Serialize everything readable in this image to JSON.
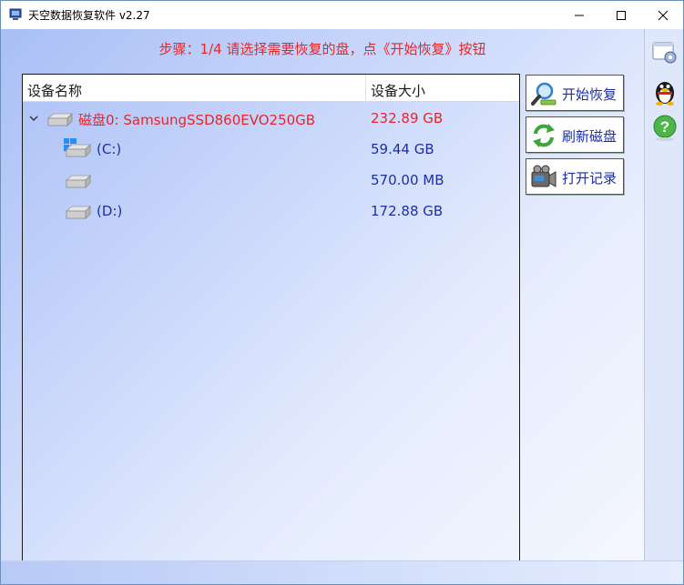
{
  "window": {
    "title": "天空数据恢复软件 v2.27"
  },
  "step": {
    "text": "步骤：1/4 请选择需要恢复的盘，点《开始恢复》按钮"
  },
  "device_list": {
    "columns": [
      "设备名称",
      "设备大小"
    ],
    "disk": {
      "name": "磁盘0: SamsungSSD860EVO250GB",
      "size": "232.89 GB",
      "expanded": true
    },
    "partitions": [
      {
        "name": "(C:)",
        "size": "59.44 GB",
        "icon": "windows-logo-icon"
      },
      {
        "name": "",
        "size": "570.00 MB",
        "icon": "drive-icon"
      },
      {
        "name": "(D:)",
        "size": "172.88 GB",
        "icon": "drive-icon"
      }
    ]
  },
  "actions": {
    "start": "开始恢复",
    "refresh": "刷新磁盘",
    "open_log": "打开记录"
  },
  "icons": {
    "right_strip": [
      "settings-icon",
      "qq-penguin-icon",
      "help-icon"
    ]
  },
  "colors": {
    "accent_red": "#e8262a",
    "text_blue": "#1c2fa8",
    "gradient_start": "#a9bff5",
    "gradient_end": "#f4f7fe"
  }
}
